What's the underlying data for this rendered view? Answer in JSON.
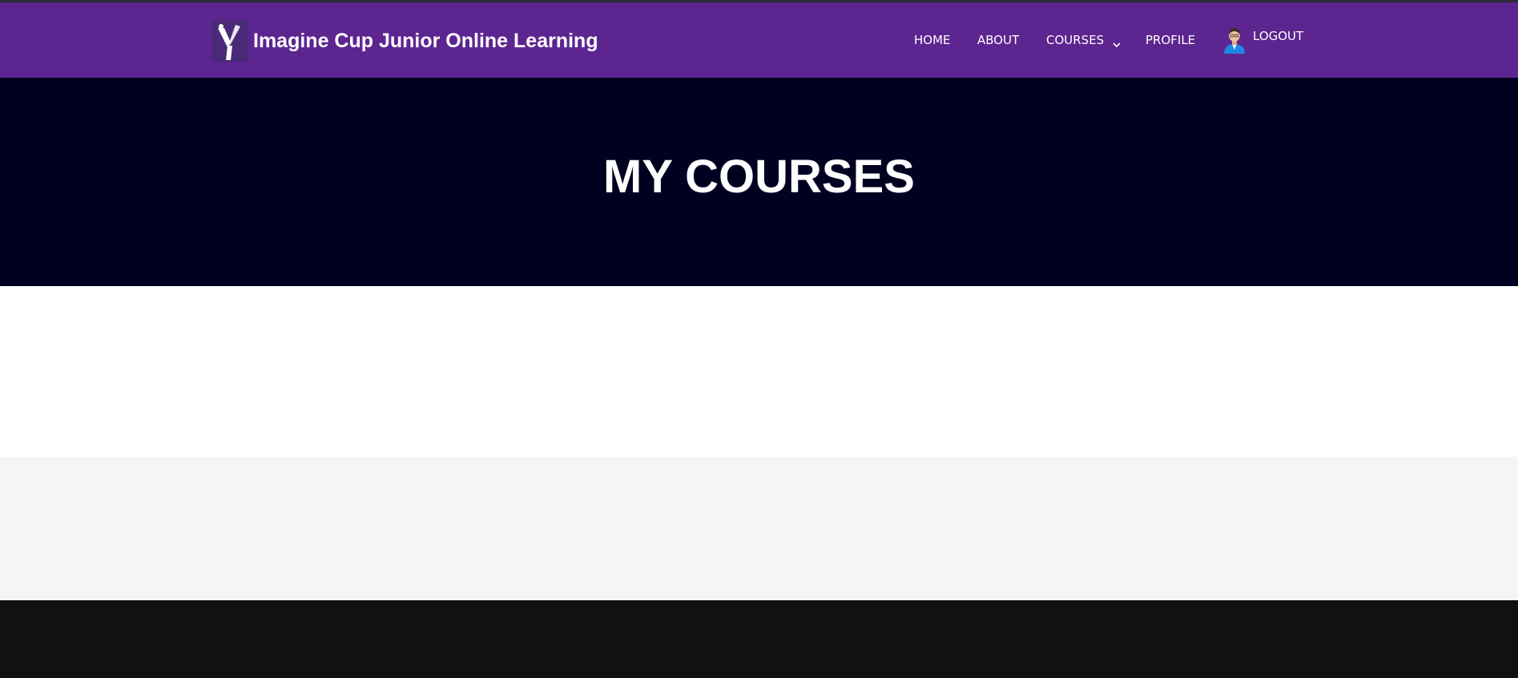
{
  "colors": {
    "navbar": "#5c2590",
    "hero": "#000020",
    "content": "#ffffff",
    "section_alt": "#f5f5f5",
    "footer": "#111111",
    "text_light": "#ffffff"
  },
  "header": {
    "brand": {
      "logo_icon": "imagine-cup-logo-icon",
      "title": "Imagine Cup Junior Online Learning"
    },
    "nav": {
      "home": "HOME",
      "about": "ABOUT",
      "courses": "COURSES",
      "courses_icon": "chevron-down-icon",
      "profile": "PROFILE",
      "logout": "LOGOUT",
      "logout_icon": "user-avatar-icon"
    }
  },
  "hero": {
    "title": "MY COURSES"
  }
}
